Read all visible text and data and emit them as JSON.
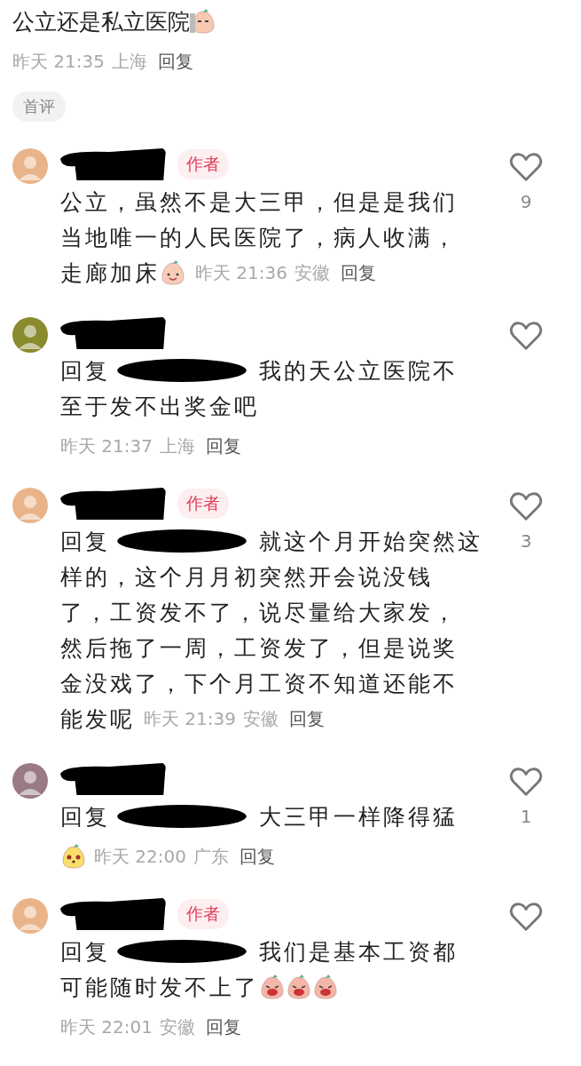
{
  "post": {
    "text": "公立还是私立医院",
    "emojis": [
      {
        "kind": "peek"
      }
    ],
    "meta": {
      "time": "昨天 21:35",
      "location": "上海",
      "reply_link": "回复"
    },
    "tag": "首评"
  },
  "comments": [
    {
      "color": "#e9b48a",
      "author_badge": "作者",
      "lines": [
        "公立，虽然不是大三甲，但是是我们",
        "当地唯一的人民医院了，病人收满，",
        "走廊加床"
      ],
      "emojis": [
        {
          "kind": "smile"
        }
      ],
      "meta_inline": true,
      "meta": {
        "time": "昨天 21:36",
        "location": "安徽",
        "reply_link": "回复"
      },
      "likes": "9"
    },
    {
      "color": "#8a8a2e",
      "reply_prefix": "回复",
      "lines": [
        "我的天公立医院不",
        "至于发不出奖金吧"
      ],
      "meta_inline": false,
      "meta": {
        "time": "昨天 21:37",
        "location": "上海",
        "reply_link": "回复"
      }
    },
    {
      "color": "#e9b48a",
      "author_badge": "作者",
      "reply_prefix": "回复",
      "lines": [
        "就这个月开始突然这",
        "样的，这个月月初突然开会说没钱",
        "了，工资发不了，说尽量给大家发，",
        "然后拖了一周，工资发了，但是说奖",
        "金没戏了，下个月工资不知道还能不",
        "能发呢"
      ],
      "meta_inline": true,
      "meta": {
        "time": "昨天 21:39",
        "location": "安徽",
        "reply_link": "回复"
      },
      "likes": "3"
    },
    {
      "color": "#9a7a86",
      "reply_prefix": "回复",
      "lines": [
        "大三甲一样降得猛"
      ],
      "meta_inline": false,
      "meta": {
        "time": "昨天 22:00",
        "location": "广东",
        "reply_link": "回复"
      },
      "likes": "1",
      "meta_emojis": [
        {
          "kind": "dog"
        }
      ]
    },
    {
      "color": "#e9b48a",
      "author_badge": "作者",
      "reply_prefix": "回复",
      "lines": [
        "我们是基本工资都",
        "可能随时发不上了"
      ],
      "emojis": [
        {
          "kind": "cry"
        },
        {
          "kind": "cry"
        },
        {
          "kind": "cry"
        }
      ],
      "meta_inline": false,
      "meta": {
        "time": "昨天 22:01",
        "location": "安徽",
        "reply_link": "回复"
      }
    }
  ]
}
